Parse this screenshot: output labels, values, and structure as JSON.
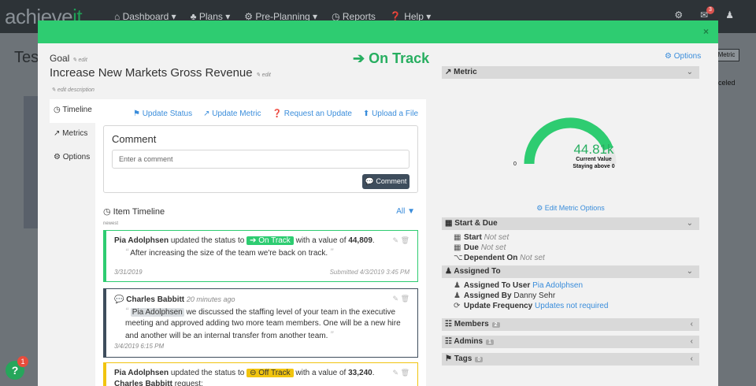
{
  "app": {
    "logo_a": "achieve",
    "logo_b": "it"
  },
  "nav": {
    "dashboard": "Dashboard ▾",
    "plans": "Plans ▾",
    "preplanning": "Pre-Planning ▾",
    "reports": "Reports",
    "help": "Help ▾",
    "notif_count": "3"
  },
  "background": {
    "title": "Tes",
    "btn": "Metric",
    "side": "celed",
    "help_count": "1",
    "help_label": "?"
  },
  "modal": {
    "close": "×",
    "goal_label": "Goal",
    "edit": "edit",
    "title": "Increase New Markets Gross Revenue",
    "edit_description": "edit description",
    "status": "On Track",
    "options": "Options"
  },
  "tabs": [
    {
      "label": "Timeline"
    },
    {
      "label": "Metrics"
    },
    {
      "label": "Options"
    }
  ],
  "actions": {
    "update_status": "Update Status",
    "update_metric": "Update Metric",
    "request_update": "Request an Update",
    "upload": "Upload a File"
  },
  "comment": {
    "title": "Comment",
    "placeholder": "Enter a comment",
    "button": "Comment"
  },
  "timeline": {
    "title": "Item Timeline",
    "filter": "All",
    "newest": "newest",
    "e1": {
      "user": "Pia Adolphsen",
      "pre": "updated the status to",
      "status": "On Track",
      "mid": "with a value of",
      "value": "44,809",
      "quote": "After increasing the size of the team we're back on track.",
      "date": "3/31/2019",
      "submitted": "Submitted 4/3/2019 3:45 PM"
    },
    "e2": {
      "user": "Charles Babbitt",
      "time": "20 minutes ago",
      "mention": "Pia Adolphsen",
      "text": "we discussed the staffing level of your team in the executive meeting and approved adding two more team members. One will be a new hire and another will be an internal transfer from another team.",
      "date": "3/4/2019 6:15 PM"
    },
    "e3": {
      "user": "Pia Adolphsen",
      "pre": "updated the status to",
      "status": "Off Track",
      "mid": "with a value of",
      "value": "33,240",
      "req_user": "Charles Babbitt",
      "req": "request:"
    }
  },
  "metric": {
    "header": "Metric",
    "value": "44.81k",
    "label": "Current Value",
    "sub": "Staying above 0",
    "min": "0",
    "fraction": 0.88,
    "edit": "Edit Metric Options"
  },
  "dates": {
    "header": "Start & Due",
    "start_label": "Start",
    "start_val": "Not set",
    "due_label": "Due",
    "due_val": "Not set",
    "dep_label": "Dependent On",
    "dep_val": "Not set"
  },
  "assigned": {
    "header": "Assigned To",
    "user_label": "Assigned To User",
    "user_val": "Pia Adolphsen",
    "by_label": "Assigned By",
    "by_val": "Danny Sehr",
    "freq_label": "Update Frequency",
    "freq_val": "Updates not required"
  },
  "members": {
    "header": "Members",
    "count": "2"
  },
  "admins": {
    "header": "Admins",
    "count": "1"
  },
  "tags": {
    "header": "Tags",
    "count": "0"
  },
  "colors": {
    "accent": "#2ecc71",
    "link": "#3a8ddb",
    "warn": "#f1c40f",
    "dark": "#3e4d5c"
  }
}
